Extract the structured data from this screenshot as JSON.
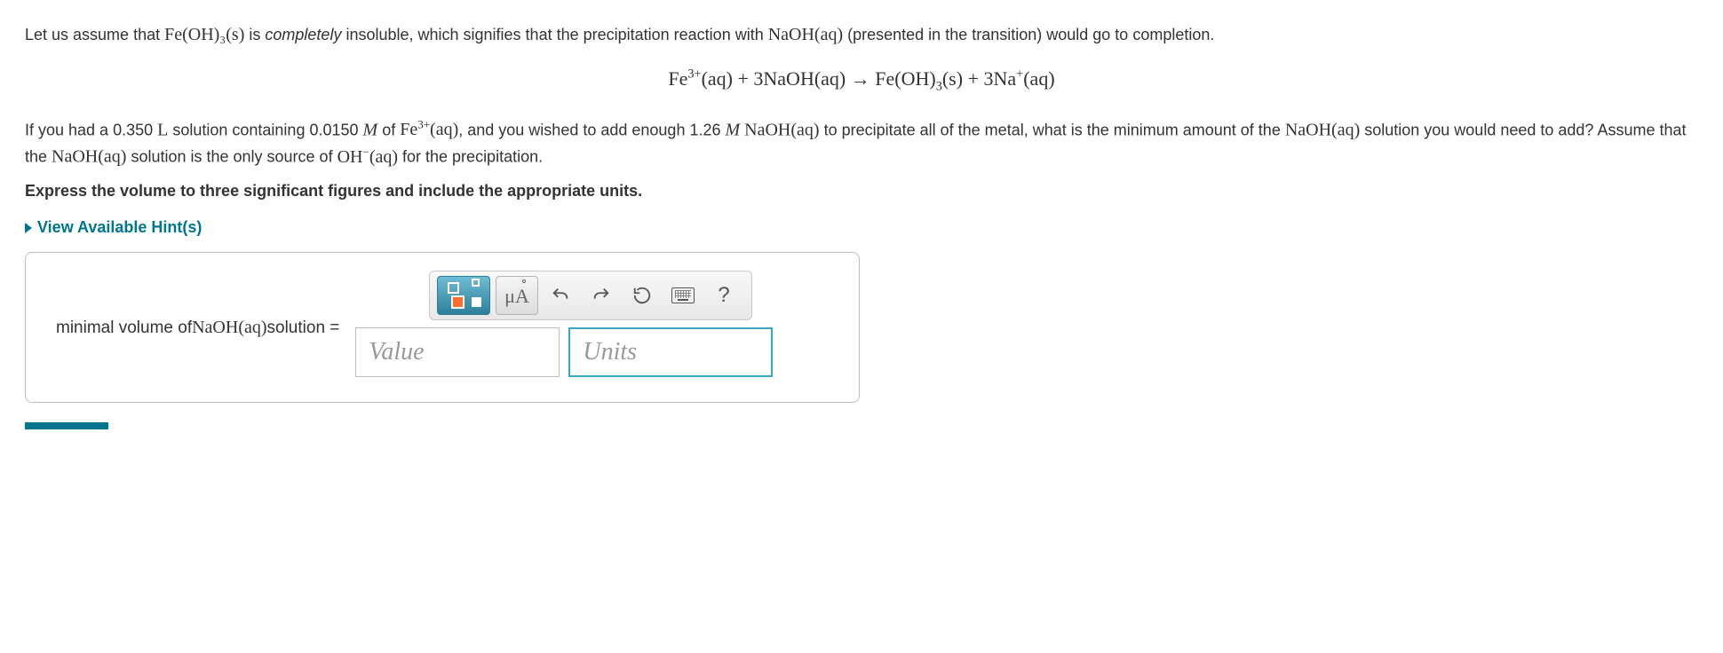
{
  "intro": {
    "p1_pre": "Let us assume that ",
    "p1_chem": "Fe(OH)₃(s)",
    "p1_mid": " is ",
    "p1_ital": "completely",
    "p1_post": " insoluble, which signifies that the precipitation reaction with ",
    "p1_chem2": "NaOH(aq)",
    "p1_end": " (presented in the transition) would go to completion."
  },
  "equation": {
    "fe": "Fe",
    "fe_sup": "3+",
    "aq": "(aq)",
    "plus": " + ",
    "coef3": "3",
    "naoh": "NaOH(aq)",
    "arrow": " → ",
    "feoh": "Fe(OH)",
    "sub3": "3",
    "s": "(s)",
    "na": "Na",
    "na_sup": "+"
  },
  "q": {
    "p2_pre": "If you had a 0.350 ",
    "L": "L",
    "p2_a": " solution containing 0.0150 ",
    "M": "M",
    "p2_b": " of ",
    "fe3": "Fe",
    "fe3_sup": "3+",
    "aq": "(aq)",
    "p2_c": ", and you wished to add enough 1.26 ",
    "p2_d": " ",
    "naoh": "NaOH(aq)",
    "p2_e": " to precipitate all of the metal, what is the minimum amount of the ",
    "p2_f": " solution you would need to add? Assume that the ",
    "p2_g": " solution is the only source of ",
    "oh": "OH",
    "oh_sup": "−",
    "p2_h": " for the precipitation."
  },
  "instruction": "Express the volume to three significant figures and include the appropriate units.",
  "hints_label": "View Available Hint(s)",
  "answer_label_pre": "minimal volume of ",
  "answer_label_chem": "NaOH(aq)",
  "answer_label_post": " solution =",
  "value_placeholder": "Value",
  "units_placeholder": "Units",
  "toolbar": {
    "mu_a": "μA",
    "help": "?"
  }
}
